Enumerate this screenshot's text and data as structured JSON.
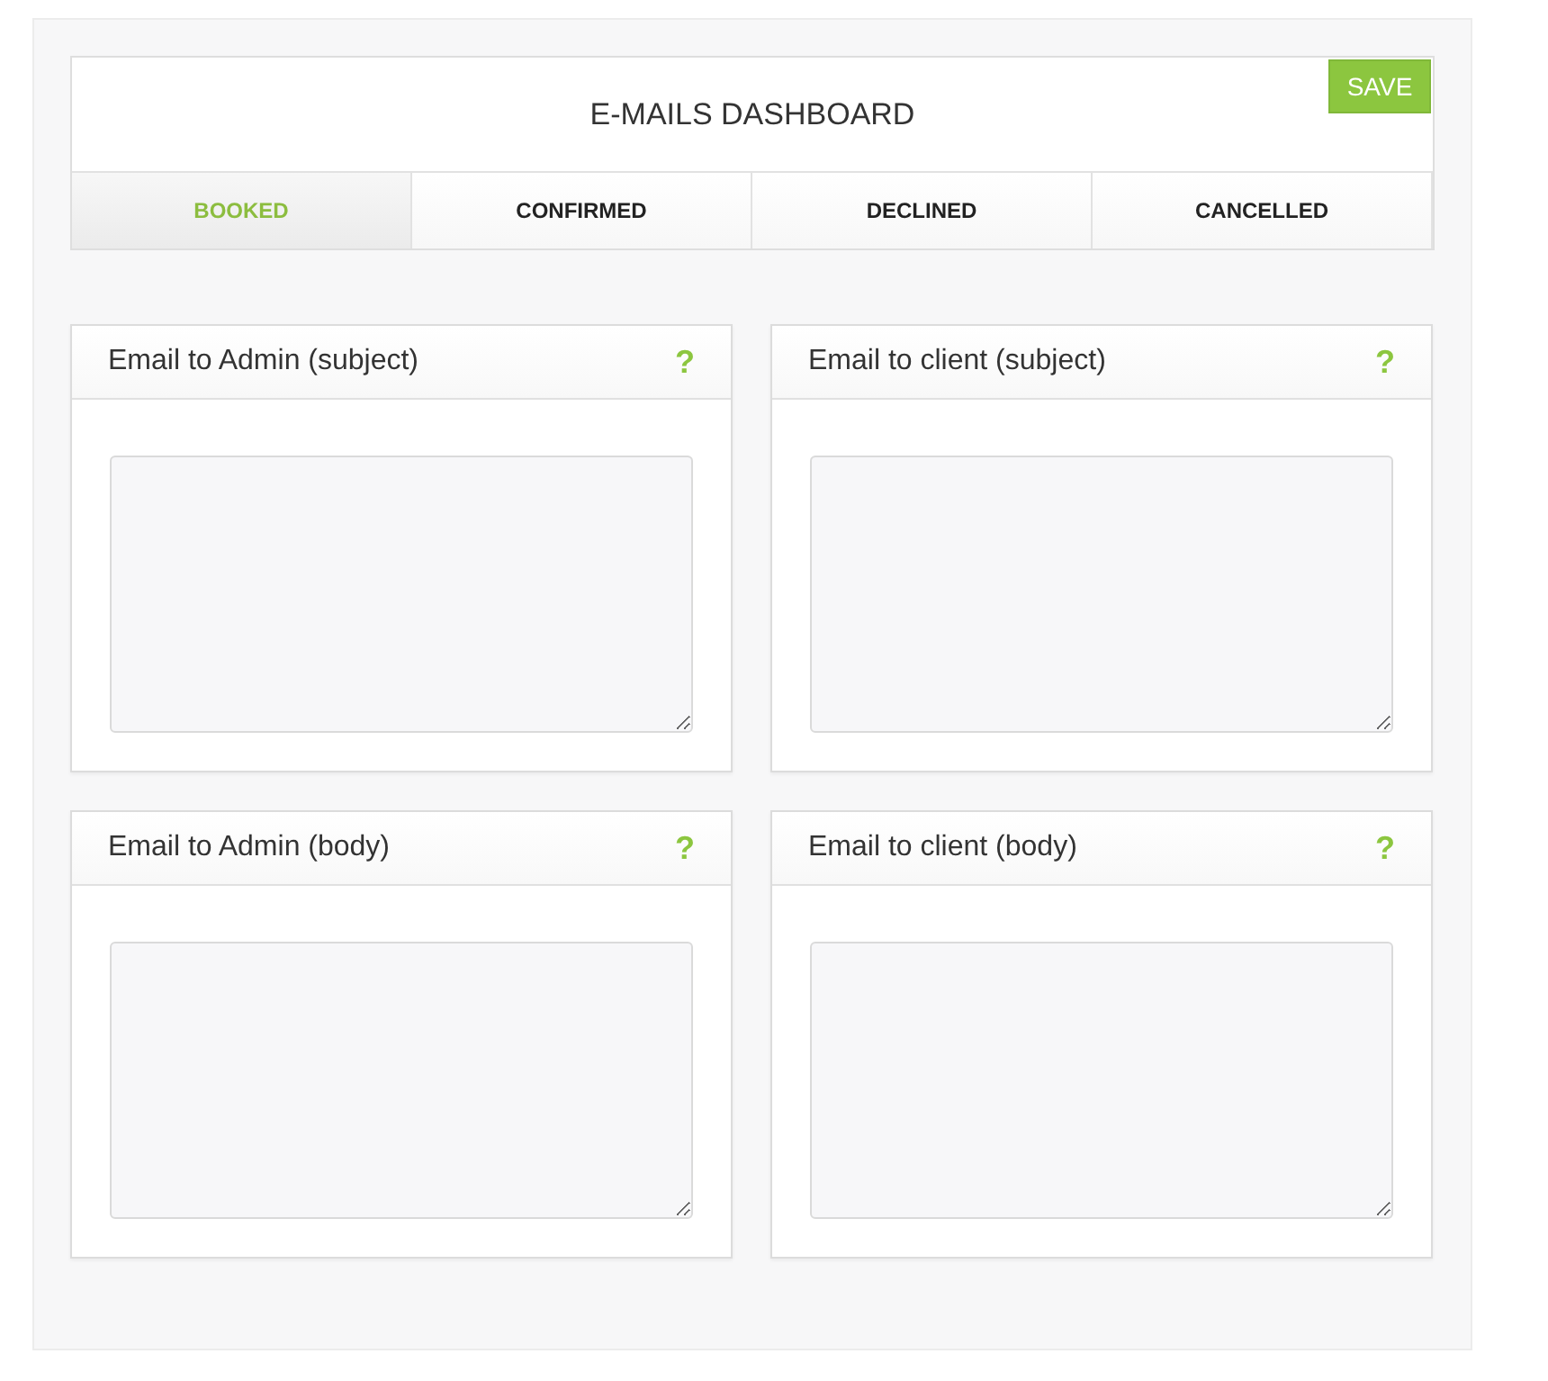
{
  "header": {
    "title": "E-MAILS DASHBOARD",
    "save_button": "SAVE"
  },
  "tabs": [
    {
      "label": "BOOKED",
      "selected": true
    },
    {
      "label": "CONFIRMED",
      "selected": false
    },
    {
      "label": "DECLINED",
      "selected": false
    },
    {
      "label": "CANCELLED",
      "selected": false
    }
  ],
  "cards": [
    {
      "title": "Email to Admin (subject)",
      "help": "?"
    },
    {
      "title": "Email to client (subject)",
      "help": "?"
    },
    {
      "title": "Email to Admin (body)",
      "help": "?"
    },
    {
      "title": "Email to client (body)",
      "help": "?"
    }
  ]
}
